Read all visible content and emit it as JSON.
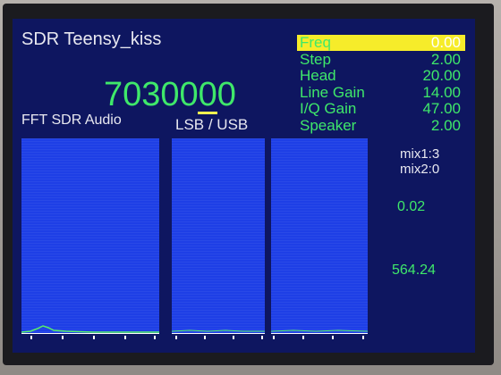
{
  "screen": {
    "title": "SDR Teensy_kiss",
    "frequency": "7030000",
    "fft_label": "FFT SDR Audio",
    "mode_label": "LSB / USB"
  },
  "params": [
    {
      "name": "Freq",
      "value": "0.00",
      "selected": true
    },
    {
      "name": "Step",
      "value": "2.00",
      "selected": false
    },
    {
      "name": "Head",
      "value": "20.00",
      "selected": false
    },
    {
      "name": "Line Gain",
      "value": "14.00",
      "selected": false
    },
    {
      "name": "I/Q Gain",
      "value": "47.00",
      "selected": false
    },
    {
      "name": "Speaker",
      "value": "2.00",
      "selected": false
    }
  ],
  "status": {
    "mix1": "mix1:3",
    "mix2": "mix2:0",
    "level": "0.02",
    "rate": "564.24"
  },
  "colors": {
    "background": "#0e1660",
    "text_green": "#3fe86a",
    "text_white": "#e8e8f0",
    "highlight": "#f6ec2a",
    "panel_blue": "#1e3fe6"
  }
}
